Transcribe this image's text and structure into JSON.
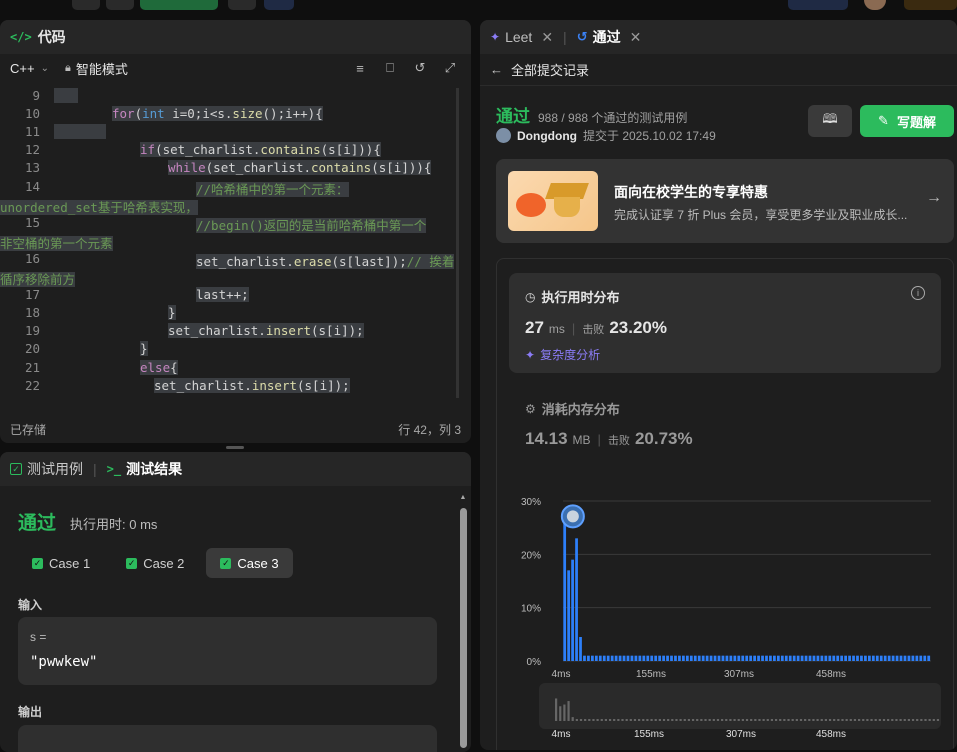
{
  "left": {
    "code_header": {
      "title": "代码"
    },
    "toolbar": {
      "language": "C++",
      "mode": "智能模式"
    },
    "code_lines": [
      {
        "n": "9",
        "text": ""
      },
      {
        "n": "10",
        "text": "for(int i=0;i<s.size();i++){"
      },
      {
        "n": "11",
        "text": ""
      },
      {
        "n": "12",
        "text": "if(set_charlist.contains(s[i])){"
      },
      {
        "n": "13",
        "text": "while(set_charlist.contains(s[i])){"
      },
      {
        "n": "14",
        "text": "//哈希桶中的第一个元素："
      },
      {
        "n": "",
        "text": "unordered_set基于哈希表实现，"
      },
      {
        "n": "15",
        "text": "//begin()返回的是当前哈希桶中第一个"
      },
      {
        "n": "",
        "text": "非空桶的第一个元素"
      },
      {
        "n": "16",
        "text": "set_charlist.erase(s[last]);// 挨着"
      },
      {
        "n": "",
        "text": "循序移除前方"
      },
      {
        "n": "17",
        "text": "last++;"
      },
      {
        "n": "18",
        "text": "}"
      },
      {
        "n": "19",
        "text": "set_charlist.insert(s[i]);"
      },
      {
        "n": "20",
        "text": "}"
      },
      {
        "n": "21",
        "text": "else{"
      },
      {
        "n": "22",
        "text": "set_charlist.insert(s[i]);"
      }
    ],
    "status": {
      "saved": "已存储",
      "position": "行 42，列 3"
    },
    "test_tabs": {
      "cases": "测试用例",
      "result": "测试结果"
    },
    "result": {
      "status": "通过",
      "runtime": "执行用时: 0 ms",
      "case_tabs": [
        "Case 1",
        "Case 2",
        "Case 3"
      ],
      "input_label": "输入",
      "input_var": "s =",
      "input_value": "\"pwwkew\"",
      "output_label": "输出"
    }
  },
  "right": {
    "tabs": {
      "leet": "Leet",
      "pass": "通过"
    },
    "back": "全部提交记录",
    "summary": {
      "status": "通过",
      "cases": "988 / 988 个通过的测试用例",
      "user": "Dongdong",
      "submitted": "提交于 2025.10.02 17:49",
      "solution_button": "写题解"
    },
    "promo": {
      "title": "面向在校学生的专享特惠",
      "desc": "完成认证享 7 折 Plus 会员，享受更多学业及职业成长..."
    },
    "runtime_card": {
      "title": "执行用时分布",
      "value": "27",
      "unit": "ms",
      "beats_label": "击败",
      "beats": "23.20%",
      "analysis": "复杂度分析"
    },
    "memory_card": {
      "title": "消耗内存分布",
      "value": "14.13",
      "unit": "MB",
      "beats_label": "击败",
      "beats": "20.73%"
    }
  },
  "chart_data": {
    "type": "bar",
    "ylim": [
      0,
      30
    ],
    "yticks": [
      "30%",
      "20%",
      "10%",
      "0%"
    ],
    "xticks": [
      "4ms",
      "155ms",
      "307ms",
      "458ms"
    ],
    "values": [
      26,
      17,
      19,
      23,
      4.5,
      1,
      1,
      1,
      1,
      1,
      1,
      1,
      1,
      1,
      1,
      1,
      1,
      1,
      1,
      1,
      1,
      1,
      1,
      1,
      1,
      1,
      1,
      1,
      1,
      1,
      1,
      1,
      1,
      1,
      1,
      1,
      1,
      1,
      1,
      1,
      1,
      1,
      1,
      1,
      1,
      1,
      1,
      1,
      1,
      1,
      1,
      1,
      1,
      1,
      1,
      1,
      1,
      1,
      1,
      1,
      1,
      1,
      1,
      1,
      1,
      1,
      1,
      1,
      1,
      1,
      1,
      1,
      1,
      1,
      1,
      1,
      1,
      1,
      1,
      1,
      1,
      1,
      1,
      1,
      1,
      1,
      1,
      1,
      1,
      1,
      1,
      1,
      1
    ],
    "highlight_index": 3,
    "bar_color": "#2d7ff9",
    "minimap_xticks": [
      "4ms",
      "155ms",
      "307ms",
      "458ms"
    ]
  },
  "colors": {
    "accent_green": "#2cbb5d",
    "chart_blue": "#2d7ff9",
    "purple": "#8b5cf6"
  }
}
